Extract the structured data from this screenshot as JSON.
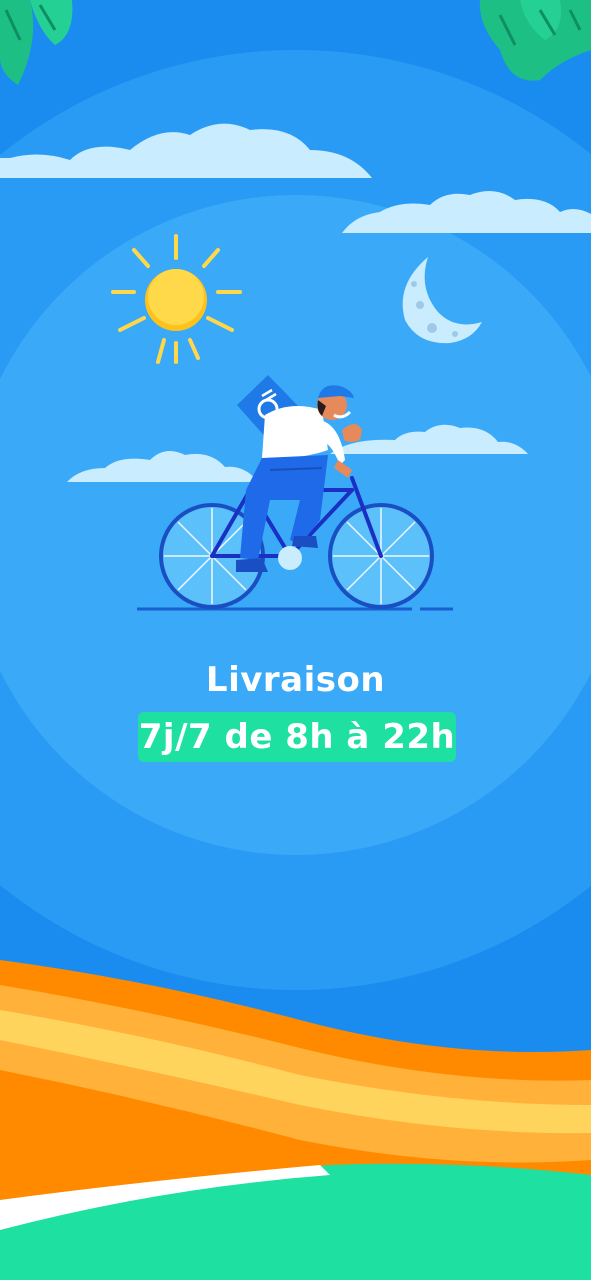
{
  "onboarding": {
    "title": "Livraison",
    "hours": "7j/7 de 8h à 22h",
    "illustration": {
      "icons": [
        "sun-icon",
        "moon-icon",
        "courier-bike-illustration",
        "palm-leaf-icon",
        "cloud-icon"
      ]
    },
    "colors": {
      "sky": "#1a8cf0",
      "circle_outer": "#2a9bf4",
      "circle_inner": "#3aaaf8",
      "badge": "#1ee0a0",
      "waves": [
        "#ff8a00",
        "#ffb13a",
        "#ffd45c"
      ],
      "ground": "#1ee0a0"
    }
  }
}
